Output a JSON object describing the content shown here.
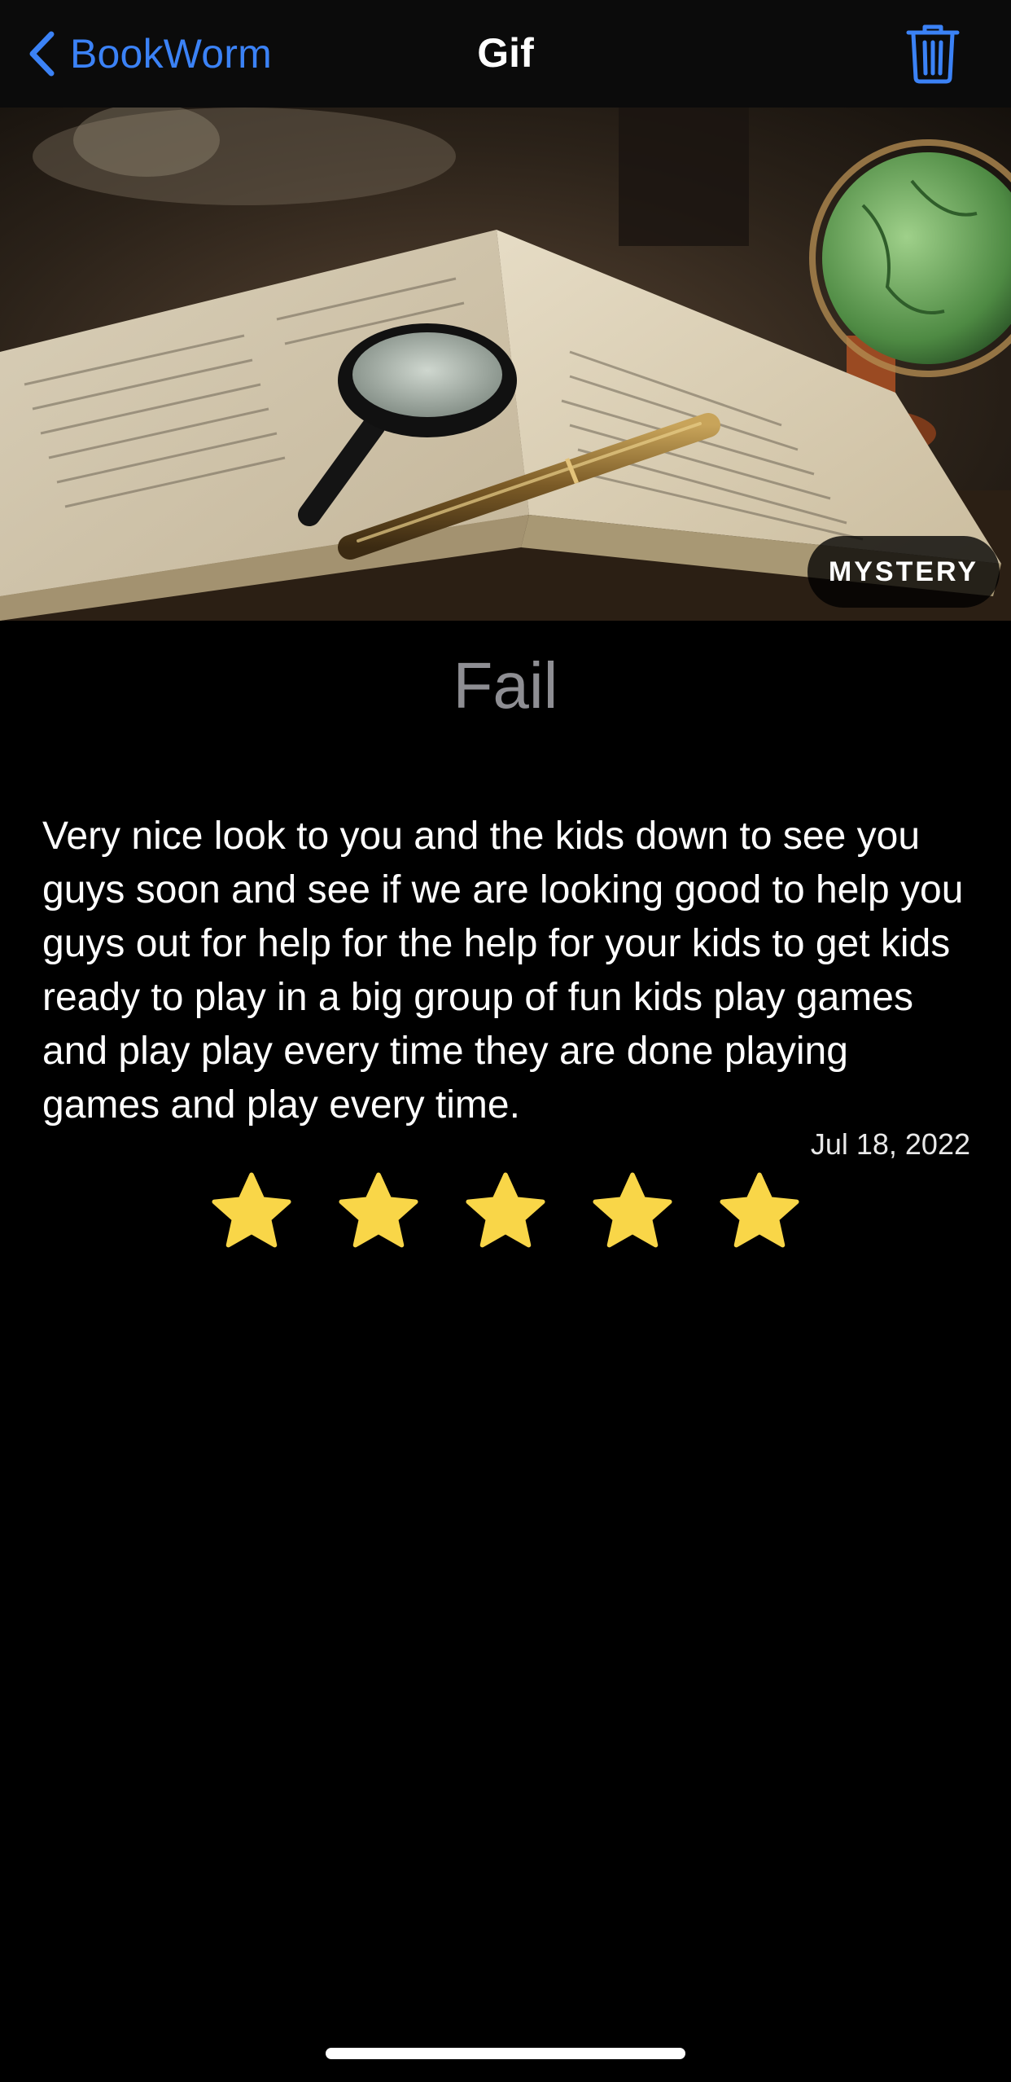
{
  "navbar": {
    "back_label": "BookWorm",
    "title": "Gif",
    "back_icon": "chevron-left-icon",
    "delete_icon": "trash-icon",
    "accent_color": "#3b82f6"
  },
  "hero": {
    "genre_badge": "MYSTERY"
  },
  "review": {
    "title": "Fail",
    "text": "Very nice look to you and the kids down to see you guys soon and see if we are looking good to help you guys out for help for the help for your kids to get kids ready to play in a big group of fun kids play games and play play every time they are done playing games and play every time.",
    "date": "Jul 18, 2022",
    "rating": 5,
    "rating_max": 5,
    "star_color": "#f9d648"
  }
}
